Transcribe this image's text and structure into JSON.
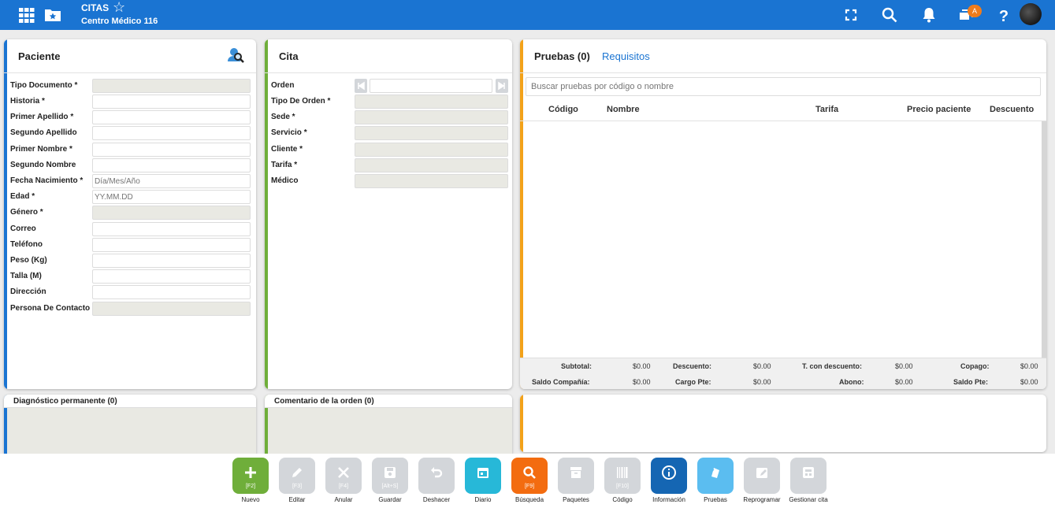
{
  "header": {
    "title": "CITAS",
    "subtitle": "Centro Médico 116",
    "notification_badge": "A",
    "colors": {
      "bar": "#1a74d2"
    }
  },
  "paciente": {
    "title": "Paciente",
    "fields": [
      {
        "label": "Tipo Documento *",
        "value": "",
        "placeholder": ""
      },
      {
        "label": "Historia *",
        "value": "",
        "placeholder": ""
      },
      {
        "label": "Primer Apellido *",
        "value": "",
        "placeholder": ""
      },
      {
        "label": "Segundo Apellido",
        "value": "",
        "placeholder": ""
      },
      {
        "label": "Primer Nombre *",
        "value": "",
        "placeholder": ""
      },
      {
        "label": "Segundo Nombre",
        "value": "",
        "placeholder": ""
      },
      {
        "label": "Fecha Nacimiento *",
        "value": "",
        "placeholder": "Día/Mes/Año"
      },
      {
        "label": "Edad *",
        "value": "",
        "placeholder": "YY.MM.DD"
      },
      {
        "label": "Género *",
        "value": "",
        "placeholder": ""
      },
      {
        "label": "Correo",
        "value": "",
        "placeholder": ""
      },
      {
        "label": "Teléfono",
        "value": "",
        "placeholder": ""
      },
      {
        "label": "Peso (Kg)",
        "value": "",
        "placeholder": ""
      },
      {
        "label": "Talla (M)",
        "value": "",
        "placeholder": ""
      },
      {
        "label": "Dirección",
        "value": "",
        "placeholder": ""
      },
      {
        "label": "Persona De Contacto",
        "value": "",
        "placeholder": ""
      }
    ]
  },
  "cita": {
    "title": "Cita",
    "fields": [
      {
        "label": "Orden"
      },
      {
        "label": "Tipo De Orden *"
      },
      {
        "label": "Sede *"
      },
      {
        "label": "Servicio *"
      },
      {
        "label": "Cliente *"
      },
      {
        "label": "Tarifa *"
      },
      {
        "label": "Médico"
      }
    ]
  },
  "pruebas": {
    "tab_active": "Pruebas (0)",
    "tab_other": "Requisitos",
    "search_placeholder": "Buscar pruebas por código o nombre",
    "columns": [
      "Código",
      "Nombre",
      "Tarifa",
      "Precio paciente",
      "Descuento"
    ],
    "totals": {
      "subtotal_label": "Subtotal:",
      "subtotal": "$0.00",
      "descuento_label": "Descuento:",
      "descuento": "$0.00",
      "tcon_label": "T. con descuento:",
      "tcon": "$0.00",
      "copago_label": "Copago:",
      "copago": "$0.00",
      "saldo_comp_label": "Saldo Compañía:",
      "saldo_comp": "$0.00",
      "cargo_label": "Cargo Pte:",
      "cargo": "$0.00",
      "abono_label": "Abono:",
      "abono": "$0.00",
      "saldo_pte_label": "Saldo Pte:",
      "saldo_pte": "$0.00"
    }
  },
  "diagnostico": {
    "title": "Diagnóstico permanente (0)"
  },
  "comentario": {
    "title": "Comentario de la orden (0)"
  },
  "toolbar": [
    {
      "label": "Nuevo",
      "key": "[F2]",
      "color": "#6fae3a",
      "icon": "plus-icon"
    },
    {
      "label": "Editar",
      "key": "[F3]",
      "color": "#d3d6da",
      "icon": "pencil-icon"
    },
    {
      "label": "Anular",
      "key": "[F4]",
      "color": "#d3d6da",
      "icon": "close-icon"
    },
    {
      "label": "Guardar",
      "key": "[Alt+S]",
      "color": "#d3d6da",
      "icon": "save-icon"
    },
    {
      "label": "Deshacer",
      "key": "",
      "color": "#d3d6da",
      "icon": "undo-icon"
    },
    {
      "label": "Diario",
      "key": "",
      "color": "#27b8d8",
      "icon": "calendar-icon"
    },
    {
      "label": "Búsqueda",
      "key": "[F9]",
      "color": "#f36c10",
      "icon": "search-icon"
    },
    {
      "label": "Paquetes",
      "key": "",
      "color": "#d3d6da",
      "icon": "archive-icon"
    },
    {
      "label": "Código",
      "key": "[F10]",
      "color": "#d3d6da",
      "icon": "barcode-icon"
    },
    {
      "label": "Información",
      "key": "",
      "color": "#1566b3",
      "icon": "info-icon"
    },
    {
      "label": "Pruebas",
      "key": "",
      "color": "#5bbdf0",
      "icon": "tests-icon"
    },
    {
      "label": "Reprogramar",
      "key": "",
      "color": "#d3d6da",
      "icon": "calendar-edit-icon"
    },
    {
      "label": "Gestionar cita",
      "key": "",
      "color": "#d3d6da",
      "icon": "manage-icon"
    }
  ]
}
